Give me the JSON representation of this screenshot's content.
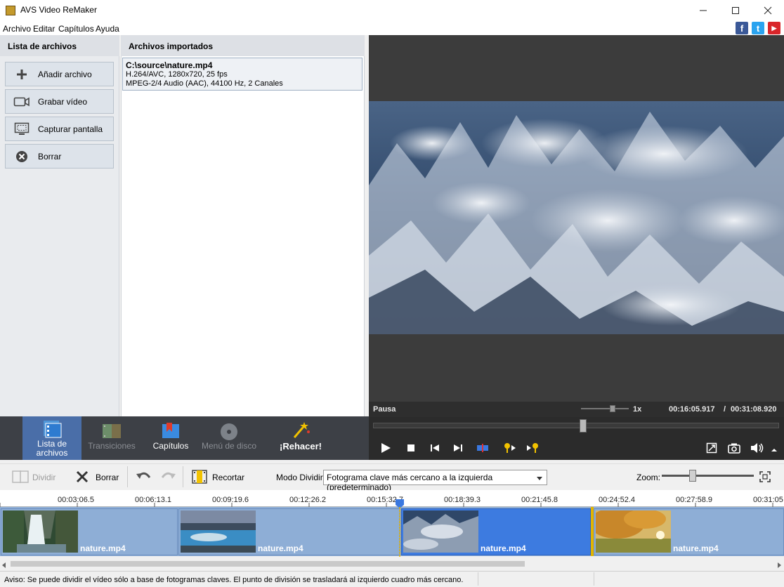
{
  "app": {
    "title": "AVS Video ReMaker"
  },
  "menu": [
    "Archivo",
    "Editar",
    "Capítulos",
    "Ayuda"
  ],
  "social": {
    "fb": "f",
    "tw": "t",
    "yt": "▶"
  },
  "file_list": {
    "header": "Lista de archivos",
    "buttons": [
      "Añadir archivo",
      "Grabar vídeo",
      "Capturar pantalla",
      "Borrar"
    ]
  },
  "imported": {
    "header": "Archivos importados",
    "path": "C:\\source\\nature.mp4",
    "video_info": "H.264/AVC, 1280x720, 25 fps",
    "audio_info": "MPEG-2/4 Audio (AAC), 44100 Hz, 2 Canales"
  },
  "player": {
    "state": "Pausa",
    "speed": "1x",
    "current_time": "00:16:05.917",
    "separator": "/",
    "total_time": "00:31:08.920",
    "progress": 0.517
  },
  "tabs": [
    {
      "label": "Lista de archivos"
    },
    {
      "label": "Transiciones"
    },
    {
      "label": "Capítulos"
    },
    {
      "label": "Menú de disco"
    },
    {
      "label": "¡Rehacer!"
    }
  ],
  "toolbar": {
    "split": "Dividir",
    "delete": "Borrar",
    "trim": "Recortar",
    "split_mode_label": "Modo Dividir:",
    "split_mode_value": "Fotograma clave más cercano a la izquierda (predeterminado)",
    "zoom_label": "Zoom:"
  },
  "ruler_ticks": [
    "00:03:06.5",
    "00:06:13.1",
    "00:09:19.6",
    "00:12:26.2",
    "00:15:32.7",
    "00:18:39.3",
    "00:21:45.8",
    "00:24:52.4",
    "00:27:58.9",
    "00:31:05"
  ],
  "clips": [
    "nature.mp4",
    "nature.mp4",
    "nature.mp4",
    "nature.mp4"
  ],
  "status": {
    "message": "Aviso: Se puede dividir el vídeo sólo a base de fotogramas claves. El punto de división se trasladará al izquierdo cuadro más cercano."
  },
  "colors": {
    "accent": "#3a78e0",
    "clip": "#8eaed6",
    "dark": "#2b2b2b"
  }
}
